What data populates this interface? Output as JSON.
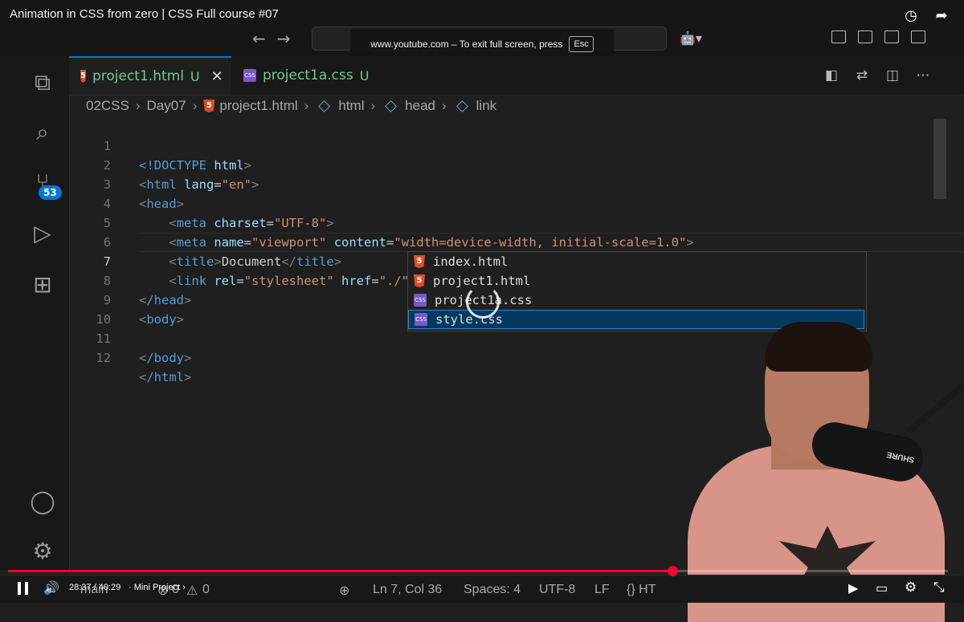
{
  "video": {
    "title": "Animation in CSS from zero | CSS Full course #07",
    "fullscreen_notice": "www.youtube.com – To exit full screen, press",
    "fullscreen_key": "Esc",
    "time_current": "28:37",
    "time_total": "40:29",
    "time_display": "28:37 / 40:29",
    "chapter": "Mini Project",
    "chapter_display": "· Mini Project ›",
    "progress": 0.7069
  },
  "editor": {
    "tabs": [
      {
        "name": "project1.html",
        "status": "U",
        "type": "html"
      },
      {
        "name": "project1a.css",
        "status": "U",
        "type": "css"
      }
    ],
    "breadcrumb": [
      "02CSS",
      "Day07",
      "project1.html",
      "html",
      "head",
      "link"
    ],
    "scm_badge": "53",
    "current_line": "7",
    "lines": [
      "1",
      "2",
      "3",
      "4",
      "5",
      "6",
      "7",
      "8",
      "9",
      "10",
      "11",
      "12"
    ],
    "suggestions": [
      {
        "label": "index.html",
        "type": "html"
      },
      {
        "label": "project1.html",
        "type": "html"
      },
      {
        "label": "project1a.css",
        "type": "css"
      },
      {
        "label": "style.css",
        "type": "css",
        "selected": true
      }
    ],
    "code": {
      "l1_doctype": "<!DOCTYPE",
      "l1_html": "html",
      "l2_tag": "html",
      "l2_attr": "lang",
      "l2_val": "\"en\"",
      "l3_tag": "head",
      "l4_tag": "meta",
      "l4_attr": "charset",
      "l4_val": "\"UTF-8\"",
      "l5_tag": "meta",
      "l5_attr1": "name",
      "l5_val1": "\"viewport\"",
      "l5_attr2": "content",
      "l5_val2": "\"width=device-width, initial-scale=1.0\"",
      "l6_tag": "title",
      "l6_text": "Document",
      "l7_tag": "link",
      "l7_attr1": "rel",
      "l7_val1": "\"stylesheet\"",
      "l7_attr2": "href",
      "l7_val2": "\"./\"",
      "l8_tag": "/head",
      "l9_tag": "body",
      "l11_tag": "/body",
      "l12_tag": "/html"
    }
  },
  "statusbar": {
    "branch": "main",
    "errors": "0",
    "warnings": "0",
    "position": "Ln 7, Col 36",
    "spaces": "Spaces: 4",
    "encoding": "UTF-8",
    "eol": "LF",
    "language": "{} HT"
  },
  "misc": {
    "mic_brand": "SHURE"
  }
}
